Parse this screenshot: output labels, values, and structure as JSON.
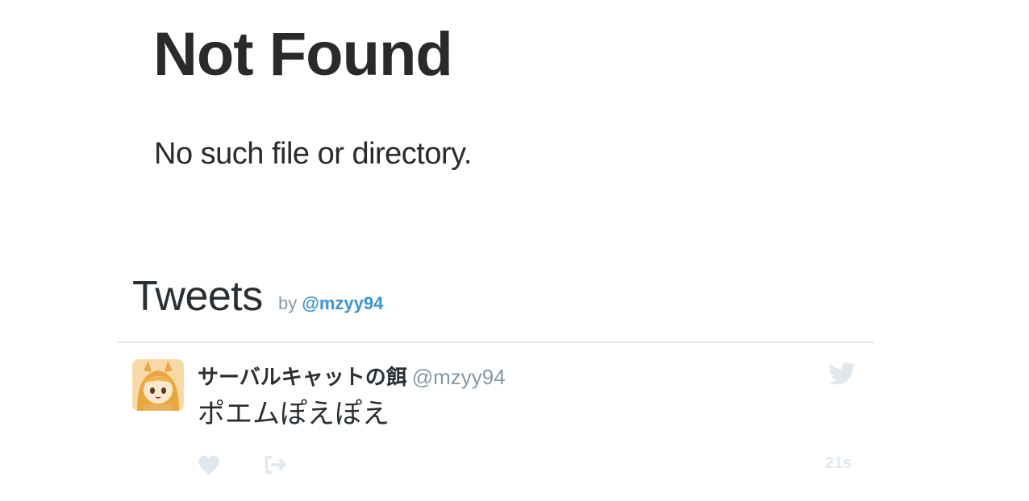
{
  "error": {
    "title": "Not Found",
    "message": "No such file or directory."
  },
  "timeline": {
    "title": "Tweets",
    "byline_prefix": "by",
    "byline_handle": "@mzyy94",
    "tweet": {
      "author_name": "サーバルキャットの餌",
      "author_handle": "@mzyy94",
      "text": "ポエムぽえぽえ",
      "time": "21s"
    }
  },
  "colors": {
    "text": "#292f33",
    "muted": "#8899a6",
    "link": "#3b94d9",
    "divider": "#e1e8ed",
    "faint_icon": "#e1e8ed"
  },
  "icons": {
    "brand": "twitter-bird-icon",
    "like": "heart-icon",
    "share": "share-icon"
  }
}
